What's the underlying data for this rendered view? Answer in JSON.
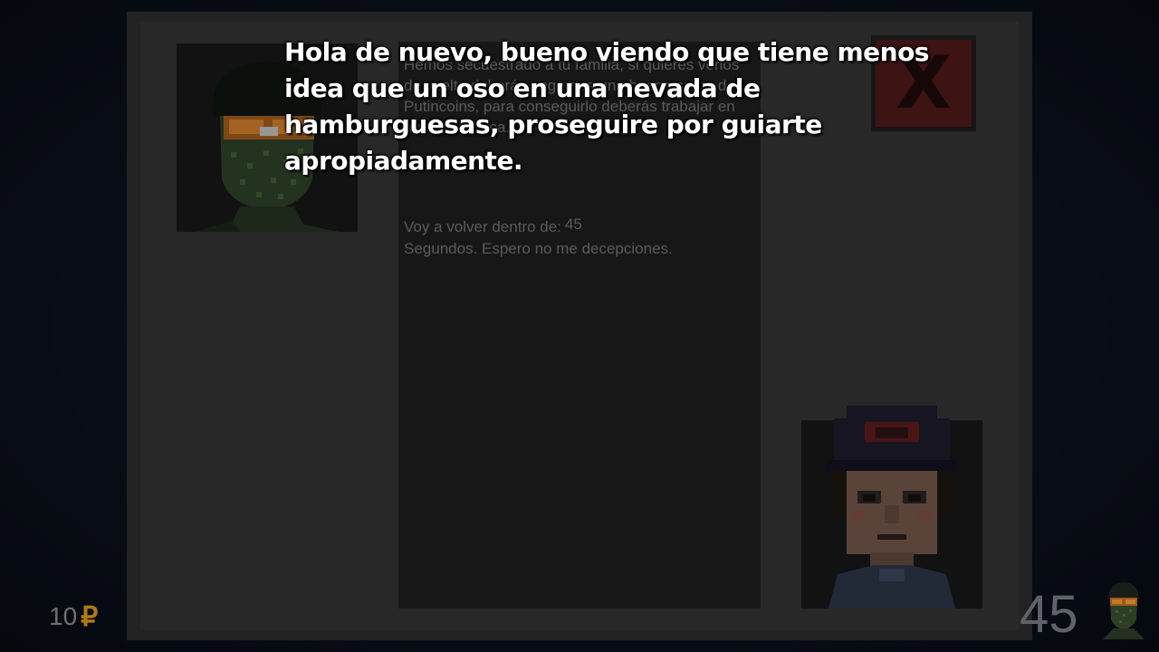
{
  "letter": {
    "body": "Hemos secuestrado a tu familia, si quieres verlos de vuelta deberás pagarnos una buena suma de Putincoins, para conseguirlo deberás trabajar en nuestra fábrica.",
    "timer_prefix": "Voy a volver dentro de:",
    "timer_value": "45",
    "timer_suffix": "Segundos. Espero no me decepciones."
  },
  "close_button": {
    "label": "X"
  },
  "dialog": {
    "text": "Hola de nuevo, bueno viendo que tiene menos idea que un oso en una nevada de hamburguesas, proseguire por guiarte apropiadamente."
  },
  "hud": {
    "money_amount": "10",
    "currency_symbol": "₽",
    "countdown": "45"
  },
  "colors": {
    "panel": "#2b2b2b",
    "letter_bg": "#1d1d1d",
    "close_red": "#4b1818",
    "currency": "#b07a12",
    "dialog_text": "#ffffff"
  },
  "icons": {
    "left_portrait": "masked-soldier-portrait",
    "right_portrait": "boy-with-cap-portrait",
    "mini_avatar": "masked-soldier-icon"
  }
}
